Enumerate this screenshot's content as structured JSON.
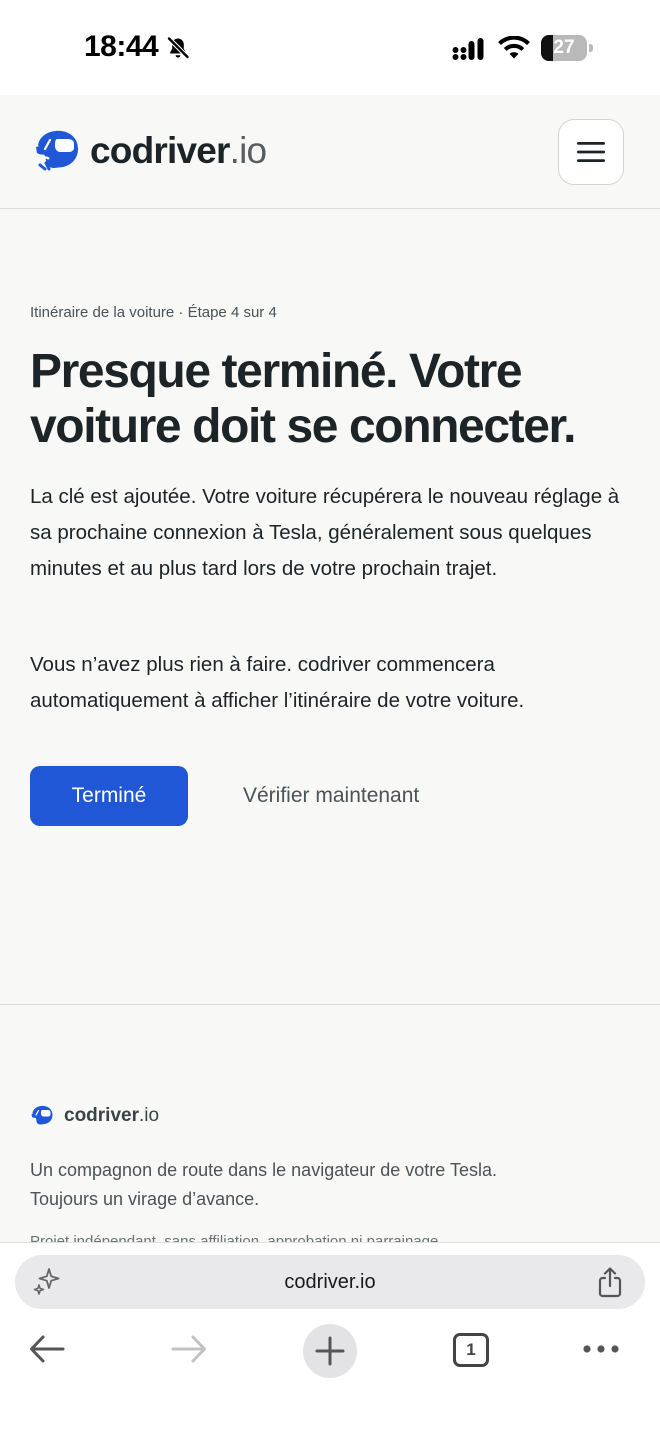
{
  "status_bar": {
    "time": "18:44",
    "battery": "27",
    "battery_level": 0.27
  },
  "header": {
    "logo_name": "codriver",
    "logo_tld": ".io",
    "menu_icon": "hamburger-menu-icon"
  },
  "main": {
    "step_label": "Itinéraire de la voiture · Étape 4 sur 4",
    "title": "Presque terminé. Votre voiture doit se connecter.",
    "paragraph_1": "La clé est ajoutée. Votre voiture récupérera le nouveau réglage à sa prochaine connexion à Tesla, généralement sous quelques minutes et au plus tard lors de votre prochain trajet.",
    "paragraph_2": "Vous n’avez plus rien à faire. codriver commencera automatiquement à afficher l’itinéraire de votre voiture.",
    "done_button": "Terminé",
    "verify_link": "Vérifier maintenant"
  },
  "footer": {
    "logo_name": "codriver",
    "logo_tld": ".io",
    "tagline": "Un compagnon de route dans le navigateur de votre Tesla. Toujours un virage d’avance.",
    "disclaimer": "Projet indépendant, sans affiliation, approbation ni parrainage"
  },
  "browser": {
    "url": "codriver.io",
    "tab_count": "1"
  },
  "colors": {
    "accent": "#1f57d6",
    "background": "#f8f8f6",
    "text": "#1c2428"
  }
}
